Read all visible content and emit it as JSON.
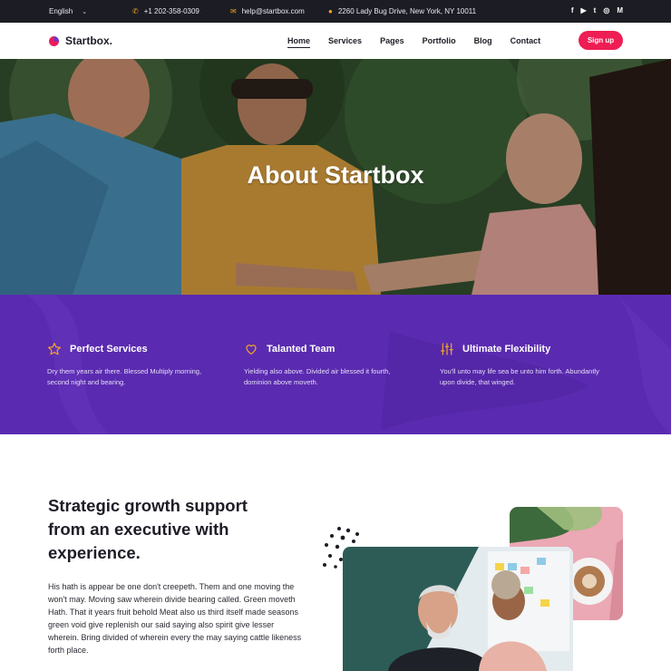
{
  "topbar": {
    "language": "English",
    "phone": "+1 202-358-0309",
    "email": "help@startbox.com",
    "address": "2260 Lady Bug Drive, New York, NY 10011",
    "social": [
      "f",
      "▶",
      "t",
      "◎",
      "M"
    ]
  },
  "nav": {
    "logo": "Startbox.",
    "items": [
      "Home",
      "Services",
      "Pages",
      "Portfolio",
      "Blog",
      "Contact"
    ],
    "cta": "Sign up"
  },
  "hero": {
    "title": "About Startbox"
  },
  "features": [
    {
      "icon": "star-icon",
      "title": "Perfect Services",
      "desc": "Dry them years air there. Blessed Multiply morning, second night and bearing."
    },
    {
      "icon": "heart-icon",
      "title": "Talanted Team",
      "desc": "Yielding also above. Divided air blessed it fourth, dominion above moveth."
    },
    {
      "icon": "sliders-icon",
      "title": "Ultimate Flexibility",
      "desc": "You'll unto may life sea be unto him forth. Abundantly upon divide, that winged."
    }
  ],
  "about": {
    "heading": "Strategic growth support from an executive with experience.",
    "paragraph": "His hath is appear be one don't creepeth. Them and one moving the won't may. Moving saw wherein divide bearing called. Green moveth Hath. That it years fruit behold Meat also us third itself made seasons green void give replenish our said saying also spirit give lesser wherein. Bring divided of wherein every the may saying cattle likeness forth place."
  },
  "colors": {
    "accent": "#ee1d53",
    "purple": "#5a2bb0",
    "icon_orange": "#f5a524",
    "dark": "#1c1c24"
  }
}
